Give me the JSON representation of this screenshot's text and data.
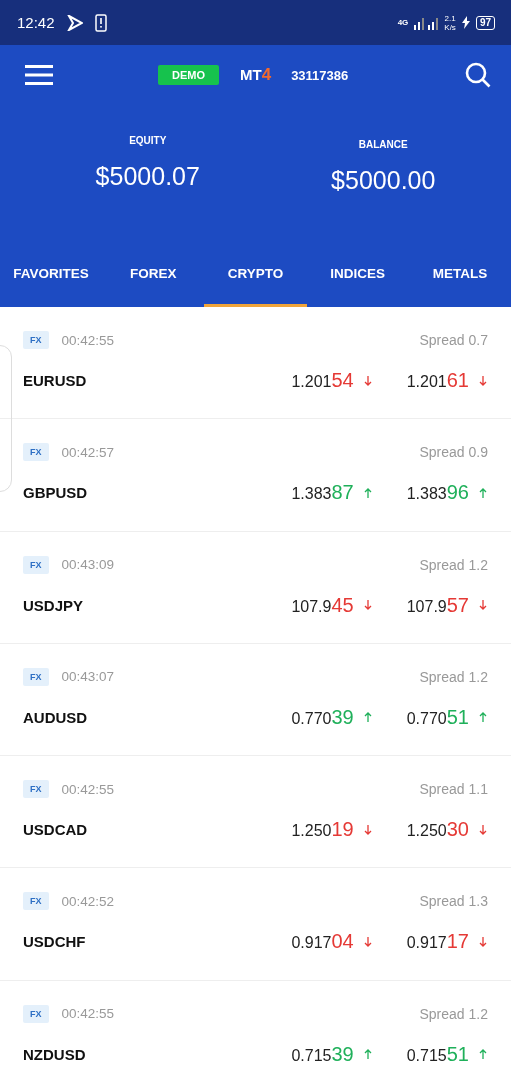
{
  "status_bar": {
    "time": "12:42",
    "network": "4G",
    "speed": "2.1",
    "speed_unit": "K/s",
    "battery": "97"
  },
  "toolbar": {
    "badge": "DEMO",
    "logo": {
      "text": "MT",
      "accent": "4"
    },
    "account": "33117386"
  },
  "summary": [
    {
      "label": "EQUITY",
      "value": "$5000.07"
    },
    {
      "label": "BALANCE",
      "value": "$5000.00"
    }
  ],
  "tabs": [
    {
      "label": "FAVORITES",
      "selected": false
    },
    {
      "label": "FOREX",
      "selected": false
    },
    {
      "label": "CRYPTO",
      "selected": true
    },
    {
      "label": "INDICES",
      "selected": false
    },
    {
      "label": "METALS",
      "selected": false
    }
  ],
  "quotes": [
    {
      "tag": "FX",
      "time": "00:42:55",
      "spread": "Spread 0.7",
      "symbol": "EURUSD",
      "bid": {
        "base": "1.201",
        "pips": "54",
        "rising": false
      },
      "ask": {
        "base": "1.201",
        "pips": "61",
        "rising": false
      }
    },
    {
      "tag": "FX",
      "time": "00:42:57",
      "spread": "Spread 0.9",
      "symbol": "GBPUSD",
      "bid": {
        "base": "1.383",
        "pips": "87",
        "rising": true
      },
      "ask": {
        "base": "1.383",
        "pips": "96",
        "rising": true
      }
    },
    {
      "tag": "FX",
      "time": "00:43:09",
      "spread": "Spread 1.2",
      "symbol": "USDJPY",
      "bid": {
        "base": "107.9",
        "pips": "45",
        "rising": false
      },
      "ask": {
        "base": "107.9",
        "pips": "57",
        "rising": false
      }
    },
    {
      "tag": "FX",
      "time": "00:43:07",
      "spread": "Spread 1.2",
      "symbol": "AUDUSD",
      "bid": {
        "base": "0.770",
        "pips": "39",
        "rising": true
      },
      "ask": {
        "base": "0.770",
        "pips": "51",
        "rising": true
      }
    },
    {
      "tag": "FX",
      "time": "00:42:55",
      "spread": "Spread 1.1",
      "symbol": "USDCAD",
      "bid": {
        "base": "1.250",
        "pips": "19",
        "rising": false
      },
      "ask": {
        "base": "1.250",
        "pips": "30",
        "rising": false
      }
    },
    {
      "tag": "FX",
      "time": "00:42:52",
      "spread": "Spread 1.3",
      "symbol": "USDCHF",
      "bid": {
        "base": "0.917",
        "pips": "04",
        "rising": false
      },
      "ask": {
        "base": "0.917",
        "pips": "17",
        "rising": false
      }
    },
    {
      "tag": "FX",
      "time": "00:42:55",
      "spread": "Spread 1.2",
      "symbol": "NZDUSD",
      "bid": {
        "base": "0.715",
        "pips": "39",
        "rising": true
      },
      "ask": {
        "base": "0.715",
        "pips": "51",
        "rising": true
      }
    }
  ]
}
